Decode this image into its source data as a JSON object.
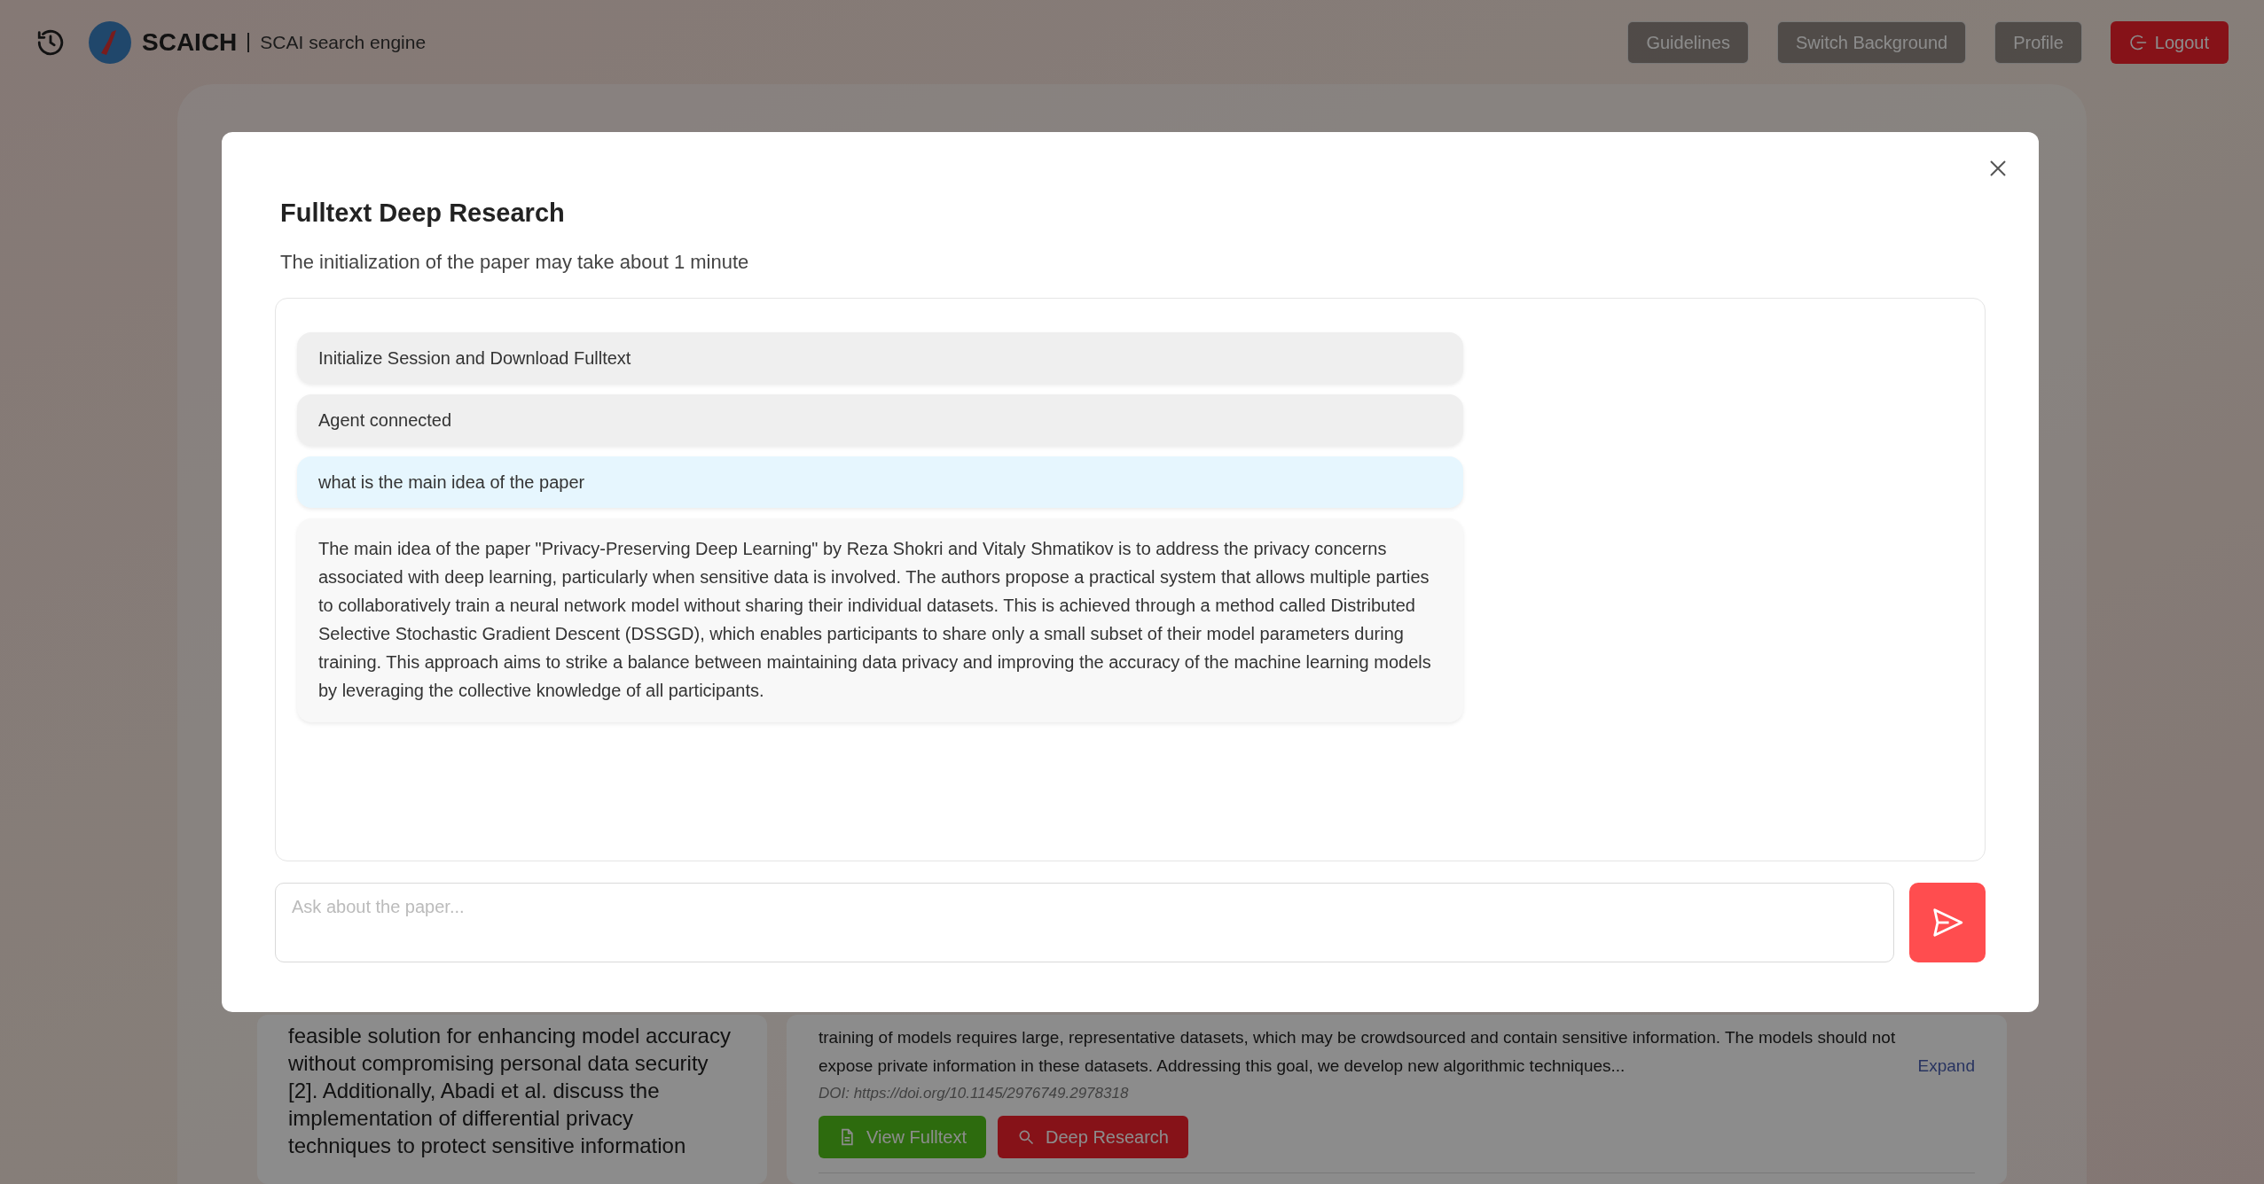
{
  "header": {
    "title": "SCAICH",
    "subtitle": "SCAI search engine",
    "buttons": [
      {
        "label": "Guidelines",
        "kind": "outline"
      },
      {
        "label": "Switch Background",
        "kind": "outline"
      },
      {
        "label": "Profile",
        "kind": "outline"
      },
      {
        "label": "Logout",
        "kind": "danger"
      }
    ]
  },
  "background_results": {
    "snippet": "feasible solution for enhancing model accuracy without compromising personal data security [2]. Additionally, Abadi et al. discuss the implementation of differential privacy techniques to protect sensitive information",
    "result": {
      "abstract": "training of models requires large, representative datasets, which may be crowdsourced and contain sensitive information. The models should not expose private information in these datasets. Addressing this goal, we develop new algorithmic techniques...",
      "expand": "Expand",
      "doi": "DOI: https://doi.org/10.1145/2976749.2978318",
      "buttons": [
        {
          "label": "View Fulltext",
          "kind": "fulltext"
        },
        {
          "label": "Deep Research",
          "kind": "research"
        }
      ]
    }
  },
  "modal": {
    "title": "Fulltext Deep Research",
    "subtitle": "The initialization of the paper may take about 1 minute",
    "messages": [
      {
        "kind": "status",
        "text": "Initialize Session and Download Fulltext"
      },
      {
        "kind": "status",
        "text": "Agent connected"
      },
      {
        "kind": "user",
        "text": "what is the main idea of the paper"
      },
      {
        "kind": "answer",
        "text": "The main idea of the paper \"Privacy-Preserving Deep Learning\" by Reza Shokri and Vitaly Shmatikov is to address the privacy concerns associated with deep learning, particularly when sensitive data is involved. The authors propose a practical system that allows multiple parties to collaboratively train a neural network model without sharing their individual datasets. This is achieved through a method called Distributed Selective Stochastic Gradient Descent (DSSGD), which enables participants to share only a small subset of their model parameters during training. This approach aims to strike a balance between maintaining data privacy and improving the accuracy of the machine learning models by leveraging the collective knowledge of all participants."
      }
    ],
    "input": {
      "placeholder": "Ask about the paper..."
    }
  }
}
